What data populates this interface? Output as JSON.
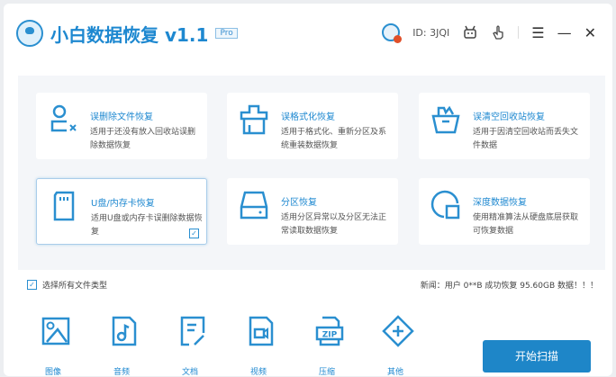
{
  "header": {
    "app_name": "小白数据恢复 v1.1",
    "badge": "Pro",
    "user_id": "ID: 3JQI"
  },
  "cards": [
    {
      "title": "误删除文件恢复",
      "desc": "适用于还没有放入回收站误删除数据恢复",
      "icon": "user-delete-icon"
    },
    {
      "title": "误格式化恢复",
      "desc": "适用于格式化、重新分区及系统重装数据恢复",
      "icon": "format-icon"
    },
    {
      "title": "误清空回收站恢复",
      "desc": "适用于因清空回收站而丢失文件数据",
      "icon": "recycle-bin-icon"
    },
    {
      "title": "U盘/内存卡恢复",
      "desc": "适用U盘或内存卡误删除数据恢复",
      "icon": "sd-card-icon",
      "selected": true
    },
    {
      "title": "分区恢复",
      "desc": "适用分区异常以及分区无法正常读取数据恢复",
      "icon": "disk-icon"
    },
    {
      "title": "深度数据恢复",
      "desc": "使用精准算法从硬盘底层获取可恢复数据",
      "icon": "deep-scan-icon"
    }
  ],
  "select_all": "选择所有文件类型",
  "news": "新闻：用户 0**B 成功恢复 95.60GB 数据！！！",
  "file_types": [
    "图像",
    "音频",
    "文档",
    "视频",
    "压缩",
    "其他"
  ],
  "scan_button": "开始扫描",
  "accent": "#1e88d0"
}
